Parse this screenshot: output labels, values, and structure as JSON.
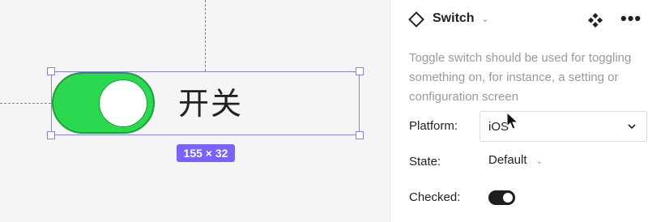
{
  "canvas": {
    "component_label": "开关",
    "size_badge": "155 × 32",
    "switch_state": "on",
    "switch_color": "#2ad94f",
    "selection_color": "#8f7ee8"
  },
  "panel": {
    "component_name": "Switch",
    "description": "Toggle switch should be used for toggling something on, for instance, a setting or configuration screen",
    "properties": {
      "platform": {
        "label": "Platform:",
        "value": "iOS"
      },
      "state": {
        "label": "State:",
        "value": "Default"
      },
      "checked": {
        "label": "Checked:",
        "value": true
      }
    },
    "icons": {
      "component": "diamond-icon",
      "components_menu": "components-icon",
      "more": "more-icon"
    }
  }
}
